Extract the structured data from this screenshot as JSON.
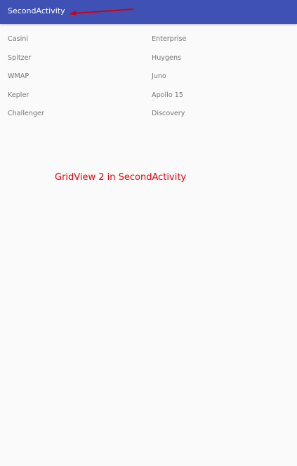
{
  "app_bar": {
    "title": "SecondActivity",
    "color": "#3f51b5"
  },
  "grid": {
    "items": [
      "Casini",
      "Enterprise",
      "Spitzer",
      "Huygens",
      "WMAP",
      "Juno",
      "Kepler",
      "Apollo 15",
      "Challenger",
      "Discovery"
    ]
  },
  "annotation": {
    "text": "GridView 2 in SecondActivity",
    "color": "#e8000b",
    "arrow_color": "#d30010"
  }
}
